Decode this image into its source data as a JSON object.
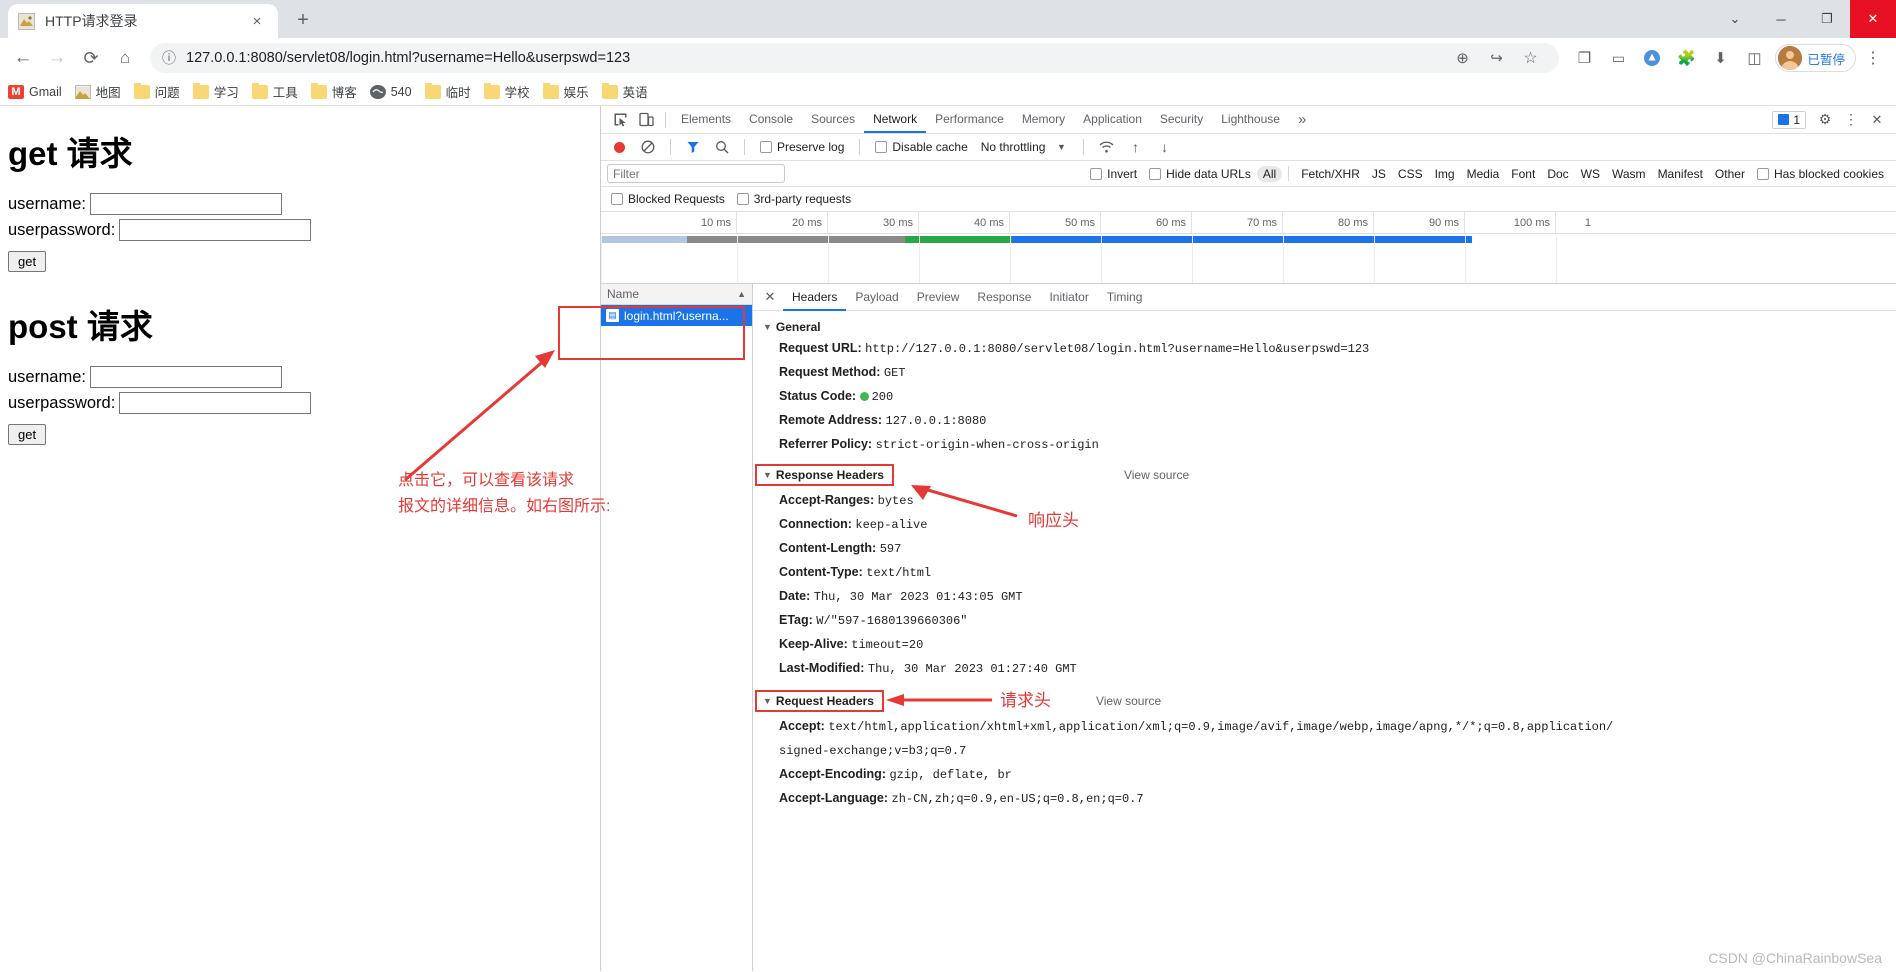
{
  "browser": {
    "tab": {
      "title": "HTTP请求登录",
      "favicon": "page-favicon",
      "close_label": "×"
    },
    "new_tab_label": "+",
    "window_controls": {
      "minimize": "─",
      "maximize": "❐",
      "close": "✕",
      "chevron": "⌄"
    },
    "toolbar": {
      "back": "←",
      "forward": "→",
      "reload": "⟳",
      "home": "⌂",
      "site_info": "ⓘ",
      "url": "127.0.0.1:8080/servlet08/login.html?username=Hello&userpswd=123",
      "zoom": "⊕",
      "share": "↪",
      "bookmark_star": "☆",
      "split": "⧉",
      "cast": "▭",
      "notify": "●",
      "extensions": "⌘",
      "download": "⬇",
      "sidepanel": "▮",
      "profile_text": "已暂停"
    },
    "bookmarks": [
      {
        "label": "Gmail",
        "icon": "gmail-icon"
      },
      {
        "label": "地图",
        "icon": "map-icon"
      },
      {
        "label": "问题",
        "icon": "folder-icon"
      },
      {
        "label": "学习",
        "icon": "folder-icon"
      },
      {
        "label": "工具",
        "icon": "folder-icon"
      },
      {
        "label": "博客",
        "icon": "folder-icon"
      },
      {
        "label": "540",
        "icon": "globe-icon"
      },
      {
        "label": "临时",
        "icon": "folder-icon"
      },
      {
        "label": "学校",
        "icon": "folder-icon"
      },
      {
        "label": "娱乐",
        "icon": "folder-icon"
      },
      {
        "label": "英语",
        "icon": "folder-icon"
      }
    ]
  },
  "webpage": {
    "get_heading": "get 请求",
    "post_heading": "post 请求",
    "username_label": "username:",
    "userpassword_label": "userpassword:",
    "get_button": "get",
    "username_value": "",
    "userpassword_value": ""
  },
  "devtools": {
    "panel_tabs": [
      "Elements",
      "Console",
      "Sources",
      "Network",
      "Performance",
      "Memory",
      "Application",
      "Security",
      "Lighthouse"
    ],
    "active_panel": "Network",
    "more_tabs": "»",
    "inspect_icon": "inspect-icon",
    "device_icon": "device-toolbar-icon",
    "issues_count": "1",
    "settings_icon": "gear-icon",
    "menu_icon": "kebab-menu-icon",
    "dock_close_icon": "close-icon",
    "network_toolbar": {
      "record": "record-button",
      "clear": "clear-button",
      "filter_icon": "funnel-icon",
      "search_icon": "search-icon",
      "preserve_log": "Preserve log",
      "disable_cache": "Disable cache",
      "throttling": "No throttling",
      "throttle_caret": "▼",
      "wifi_icon": "wifi-icon",
      "import_icon": "↑",
      "export_icon": "↓"
    },
    "filter_row": {
      "placeholder": "Filter",
      "value": "",
      "invert": "Invert",
      "hide_data_urls": "Hide data URLs",
      "types": [
        "All",
        "Fetch/XHR",
        "JS",
        "CSS",
        "Img",
        "Media",
        "Font",
        "Doc",
        "WS",
        "Wasm",
        "Manifest",
        "Other"
      ],
      "selected_type": "All",
      "has_blocked_cookies": "Has blocked cookies"
    },
    "filter_row2": {
      "blocked_requests": "Blocked Requests",
      "third_party": "3rd-party requests"
    },
    "timeline_ticks": [
      "10 ms",
      "20 ms",
      "30 ms",
      "40 ms",
      "50 ms",
      "60 ms",
      "70 ms",
      "80 ms",
      "90 ms",
      "100 ms",
      "1"
    ],
    "request_table": {
      "column_header": "Name",
      "sort_arrow": "▲",
      "rows": [
        {
          "name": "login.html?userna...",
          "icon": "document-icon",
          "selected": true
        }
      ]
    },
    "detail_tabs": [
      "Headers",
      "Payload",
      "Preview",
      "Response",
      "Initiator",
      "Timing"
    ],
    "active_detail_tab": "Headers",
    "sections": [
      {
        "title": "General",
        "view_source": "",
        "boxed": false,
        "rows": [
          {
            "key": "Request URL:",
            "value": "http://127.0.0.1:8080/servlet08/login.html?username=Hello&userpswd=123"
          },
          {
            "key": "Request Method:",
            "value": "GET"
          },
          {
            "key": "Status Code:",
            "value": "200",
            "status": true
          },
          {
            "key": "Remote Address:",
            "value": "127.0.0.1:8080"
          },
          {
            "key": "Referrer Policy:",
            "value": "strict-origin-when-cross-origin"
          }
        ]
      },
      {
        "title": "Response Headers",
        "view_source": "View source",
        "boxed": true,
        "rows": [
          {
            "key": "Accept-Ranges:",
            "value": "bytes"
          },
          {
            "key": "Connection:",
            "value": "keep-alive"
          },
          {
            "key": "Content-Length:",
            "value": "597"
          },
          {
            "key": "Content-Type:",
            "value": "text/html"
          },
          {
            "key": "Date:",
            "value": "Thu, 30 Mar 2023 01:43:05 GMT"
          },
          {
            "key": "ETag:",
            "value": "W/\"597-1680139660306\""
          },
          {
            "key": "Keep-Alive:",
            "value": "timeout=20"
          },
          {
            "key": "Last-Modified:",
            "value": "Thu, 30 Mar 2023 01:27:40 GMT"
          }
        ]
      },
      {
        "title": "Request Headers",
        "view_source": "View source",
        "boxed": true,
        "rows": [
          {
            "key": "Accept:",
            "value": "text/html,application/xhtml+xml,application/xml;q=0.9,image/avif,image/webp,image/apng,*/*;q=0.8,application/"
          },
          {
            "key": "",
            "value": "signed-exchange;v=b3;q=0.7"
          },
          {
            "key": "Accept-Encoding:",
            "value": "gzip, deflate, br"
          },
          {
            "key": "Accept-Language:",
            "value": "zh-CN,zh;q=0.9,en-US;q=0.8,en;q=0.7"
          }
        ]
      }
    ]
  },
  "annotations": {
    "click_note": "点击它，可以查看该请求\n报文的详细信息。如右图所示:",
    "response_head": "响应头",
    "request_head": "请求头"
  },
  "watermark": "CSDN @ChinaRainbowSea",
  "colors": {
    "accent": "#1a73e8",
    "annotation_red": "#e53935",
    "status_green": "#3fb950",
    "tabstrip_bg": "#dee1e6",
    "bookmark_folder": "#f8d775"
  }
}
